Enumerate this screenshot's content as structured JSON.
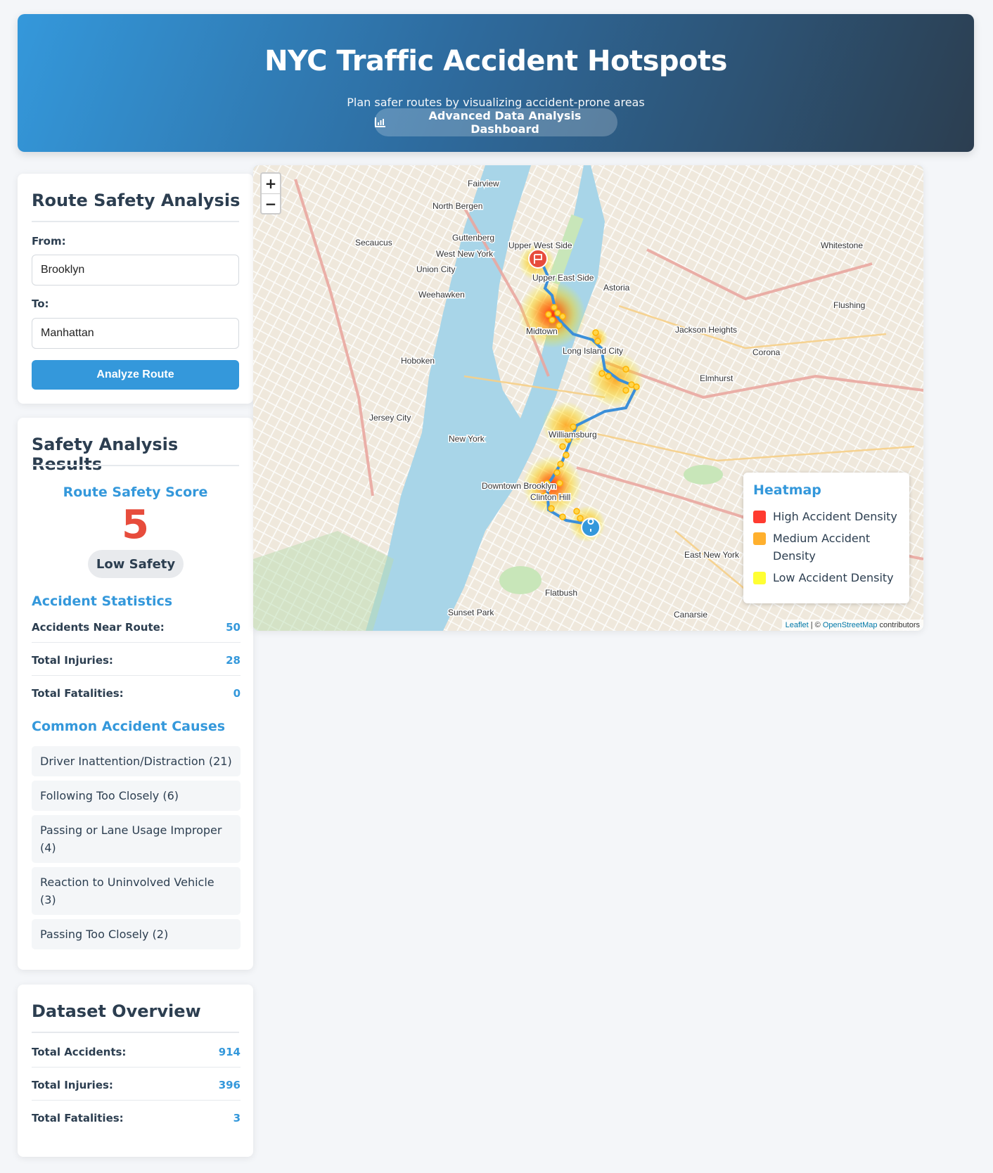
{
  "header": {
    "title": "NYC Traffic Accident Hotspots",
    "subtitle": "Plan safer routes by visualizing accident-prone areas",
    "dashboard_button": "Advanced Data Analysis Dashboard",
    "dashboard_icon": "bar-chart-icon"
  },
  "route_form": {
    "title": "Route Safety Analysis",
    "from_label": "From:",
    "from_value": "Brooklyn",
    "to_label": "To:",
    "to_value": "Manhattan",
    "analyze_label": "Analyze Route"
  },
  "results": {
    "title": "Safety Analysis Results",
    "score_title": "Route Safety Score",
    "score": "5",
    "rating": "Low Safety",
    "stats_title": "Accident Statistics",
    "stats": [
      {
        "label": "Accidents Near Route:",
        "value": "50"
      },
      {
        "label": "Total Injuries:",
        "value": "28"
      },
      {
        "label": "Total Fatalities:",
        "value": "0"
      }
    ],
    "causes_title": "Common Accident Causes",
    "causes": [
      "Driver Inattention/Distraction (21)",
      "Following Too Closely (6)",
      "Passing or Lane Usage Improper (4)",
      "Reaction to Uninvolved Vehicle (3)",
      "Passing Too Closely (2)"
    ]
  },
  "dataset": {
    "title": "Dataset Overview",
    "stats": [
      {
        "label": "Total Accidents:",
        "value": "914"
      },
      {
        "label": "Total Injuries:",
        "value": "396"
      },
      {
        "label": "Total Fatalities:",
        "value": "3"
      }
    ]
  },
  "map": {
    "zoom_in": "+",
    "zoom_out": "−",
    "labels": [
      "Fairview",
      "North Bergen",
      "Guttenberg",
      "Secaucus",
      "West New York",
      "Union City",
      "Weehawken",
      "Upper West Side",
      "Upper East Side",
      "Midtown",
      "Astoria",
      "Long Island City",
      "Hoboken",
      "Jackson Heights",
      "Flushing",
      "Corona",
      "Elmhurst",
      "Jersey City",
      "New York",
      "Williamsburg",
      "Downtown Brooklyn",
      "Clinton Hill",
      "Flatbush",
      "Sunset Park",
      "Canarsie",
      "East New York",
      "Whitestone"
    ],
    "legend": {
      "title": "Heatmap",
      "items": [
        {
          "label": "High Accident Density",
          "color": "#ff3b30"
        },
        {
          "label": "Medium Accident Density",
          "color": "#ffb02e"
        },
        {
          "label": "Low Accident Density",
          "color": "#ffff33"
        }
      ]
    },
    "attribution": {
      "leaflet": "Leaflet",
      "sep": " | © ",
      "osm": "OpenStreetMap",
      "suffix": " contributors"
    }
  },
  "colors": {
    "accent": "#3498db",
    "danger": "#e74c3c",
    "text": "#2c3e50"
  }
}
